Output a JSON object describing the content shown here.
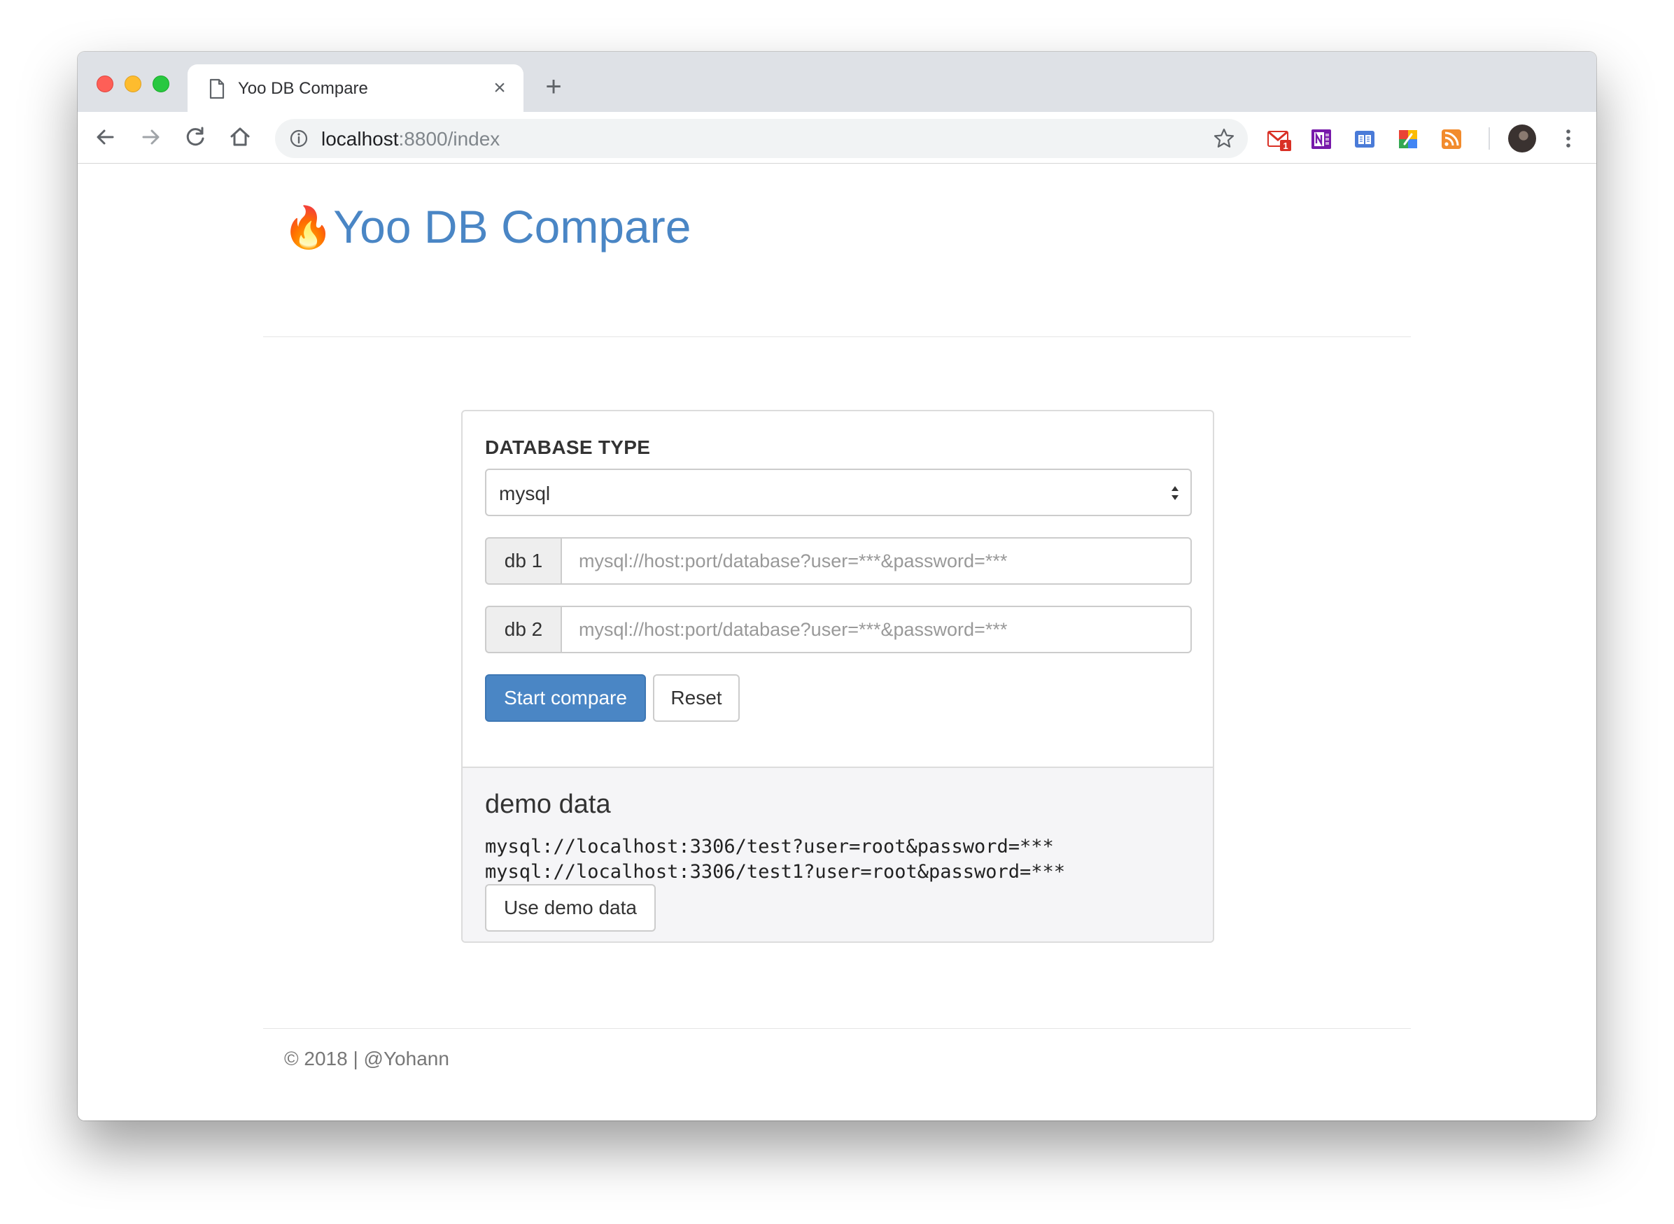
{
  "browser": {
    "tab_title": "Yoo DB Compare",
    "tab_close": "×",
    "new_tab": "+",
    "url_host": "localhost",
    "url_rest": ":8800/index",
    "extensions": [
      {
        "name": "gmail-icon",
        "badge": "1",
        "color": "#d93025"
      },
      {
        "name": "onenote-icon",
        "color": "#7719aa"
      },
      {
        "name": "reader-icon",
        "color": "#4a7bd8"
      },
      {
        "name": "colorful-extension-icon",
        "color": "#fbbc05"
      },
      {
        "name": "rss-icon",
        "color": "#f28b2c"
      }
    ]
  },
  "header": {
    "logo_emoji": "🔥",
    "title": "Yoo DB Compare"
  },
  "form": {
    "database_type_label": "DATABASE TYPE",
    "database_type_value": "mysql",
    "db1_label": "db 1",
    "db1_placeholder": "mysql://host:port/database?user=***&password=***",
    "db2_label": "db 2",
    "db2_placeholder": "mysql://host:port/database?user=***&password=***",
    "start_label": "Start compare",
    "reset_label": "Reset"
  },
  "demo": {
    "title": "demo data",
    "lines": [
      "mysql://localhost:3306/test?user=root&password=***",
      "mysql://localhost:3306/test1?user=root&password=***"
    ],
    "button_label": "Use demo data"
  },
  "footer": {
    "text": "© 2018 | @Yohann"
  },
  "colors": {
    "accent": "#4a86c5",
    "panel_footer_bg": "#f5f5f7"
  }
}
